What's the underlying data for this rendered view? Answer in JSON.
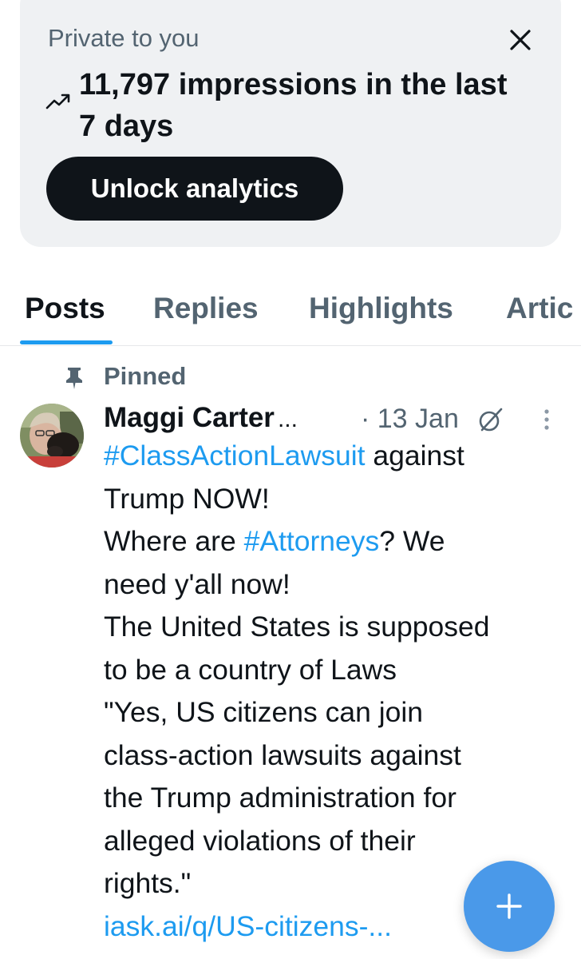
{
  "analytics_card": {
    "private_label": "Private to you",
    "headline": "11,797 impressions in the last 7 days",
    "unlock_button": "Unlock analytics",
    "close_icon": "close-icon",
    "trend_icon": "trending-up-icon"
  },
  "tabs": [
    {
      "label": "Posts",
      "active": true
    },
    {
      "label": "Replies",
      "active": false
    },
    {
      "label": "Highlights",
      "active": false
    },
    {
      "label": "Artic",
      "active": false
    }
  ],
  "post": {
    "pinned_label": "Pinned",
    "author_name": "Maggi Carter",
    "author_truncation": "...",
    "date": "· 13 Jan",
    "body_lines": [
      {
        "hashtag": "#ClassActionLawsuit",
        "text": " against"
      },
      {
        "text": "Trump NOW!"
      },
      {
        "text": "Where are ",
        "hashtag": "#Attorneys",
        "after": "? We"
      },
      {
        "text": "need y'all now!"
      },
      {
        "text": "The United States is supposed"
      },
      {
        "text": "to be a country of Laws"
      },
      {
        "text": "\"Yes, US citizens can join"
      },
      {
        "text": "class-action lawsuits against"
      },
      {
        "text": "the Trump administration for"
      },
      {
        "text": "alleged violations of their"
      },
      {
        "text": "rights.\""
      },
      {
        "link": "iask.ai/q/US-citizens-..."
      }
    ]
  },
  "fab": {
    "icon": "plus-icon"
  },
  "colors": {
    "accent": "#1d9bf0",
    "text_primary": "#0f1419",
    "text_secondary": "#536471",
    "card_bg": "#eff1f3",
    "fab_bg": "#4a99e9"
  }
}
